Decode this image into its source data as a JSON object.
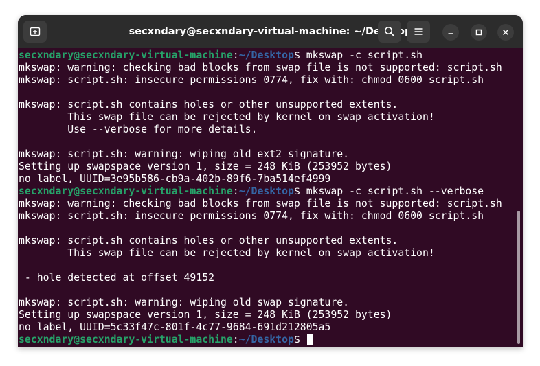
{
  "window": {
    "title": "secxndary@secxndary-virtual-machine: ~/Desktop"
  },
  "titlebar": {
    "new_tab_icon": "new-tab-icon",
    "search_icon": "search-icon",
    "menu_icon": "hamburger-menu-icon",
    "minimize_icon": "minimize-icon",
    "maximize_icon": "maximize-icon",
    "close_icon": "close-icon"
  },
  "colors": {
    "terminal_bg": "#300a24",
    "titlebar_bg": "#2c2c2c",
    "prompt_user": "#26a269",
    "prompt_path": "#3465a4",
    "text": "#ffffff"
  },
  "prompt": {
    "user_host": "secxndary@secxndary-virtual-machine",
    "colon": ":",
    "path": "~/Desktop",
    "dollar": "$ "
  },
  "terminal": {
    "lines": [
      {
        "type": "prompt",
        "command": "mkswap -c script.sh"
      },
      {
        "type": "output",
        "text": "mkswap: warning: checking bad blocks from swap file is not supported: script.sh"
      },
      {
        "type": "output",
        "text": "mkswap: script.sh: insecure permissions 0774, fix with: chmod 0600 script.sh"
      },
      {
        "type": "output",
        "text": ""
      },
      {
        "type": "output",
        "text": "mkswap: script.sh contains holes or other unsupported extents."
      },
      {
        "type": "output",
        "text": "        This swap file can be rejected by kernel on swap activation!"
      },
      {
        "type": "output",
        "text": "        Use --verbose for more details."
      },
      {
        "type": "output",
        "text": ""
      },
      {
        "type": "output",
        "text": "mkswap: script.sh: warning: wiping old ext2 signature."
      },
      {
        "type": "output",
        "text": "Setting up swapspace version 1, size = 248 KiB (253952 bytes)"
      },
      {
        "type": "output",
        "text": "no label, UUID=3e95b586-cb9a-402b-89f6-7ba514ef4999"
      },
      {
        "type": "prompt",
        "command": "mkswap -c script.sh --verbose"
      },
      {
        "type": "output",
        "text": "mkswap: warning: checking bad blocks from swap file is not supported: script.sh"
      },
      {
        "type": "output",
        "text": "mkswap: script.sh: insecure permissions 0774, fix with: chmod 0600 script.sh"
      },
      {
        "type": "output",
        "text": ""
      },
      {
        "type": "output",
        "text": "mkswap: script.sh contains holes or other unsupported extents."
      },
      {
        "type": "output",
        "text": "        This swap file can be rejected by kernel on swap activation!"
      },
      {
        "type": "output",
        "text": ""
      },
      {
        "type": "output",
        "text": " - hole detected at offset 49152"
      },
      {
        "type": "output",
        "text": ""
      },
      {
        "type": "output",
        "text": "mkswap: script.sh: warning: wiping old swap signature."
      },
      {
        "type": "output",
        "text": "Setting up swapspace version 1, size = 248 KiB (253952 bytes)"
      },
      {
        "type": "output",
        "text": "no label, UUID=5c33f47c-801f-4c77-9684-691d212805a5"
      },
      {
        "type": "prompt",
        "command": "",
        "cursor": true
      }
    ]
  }
}
